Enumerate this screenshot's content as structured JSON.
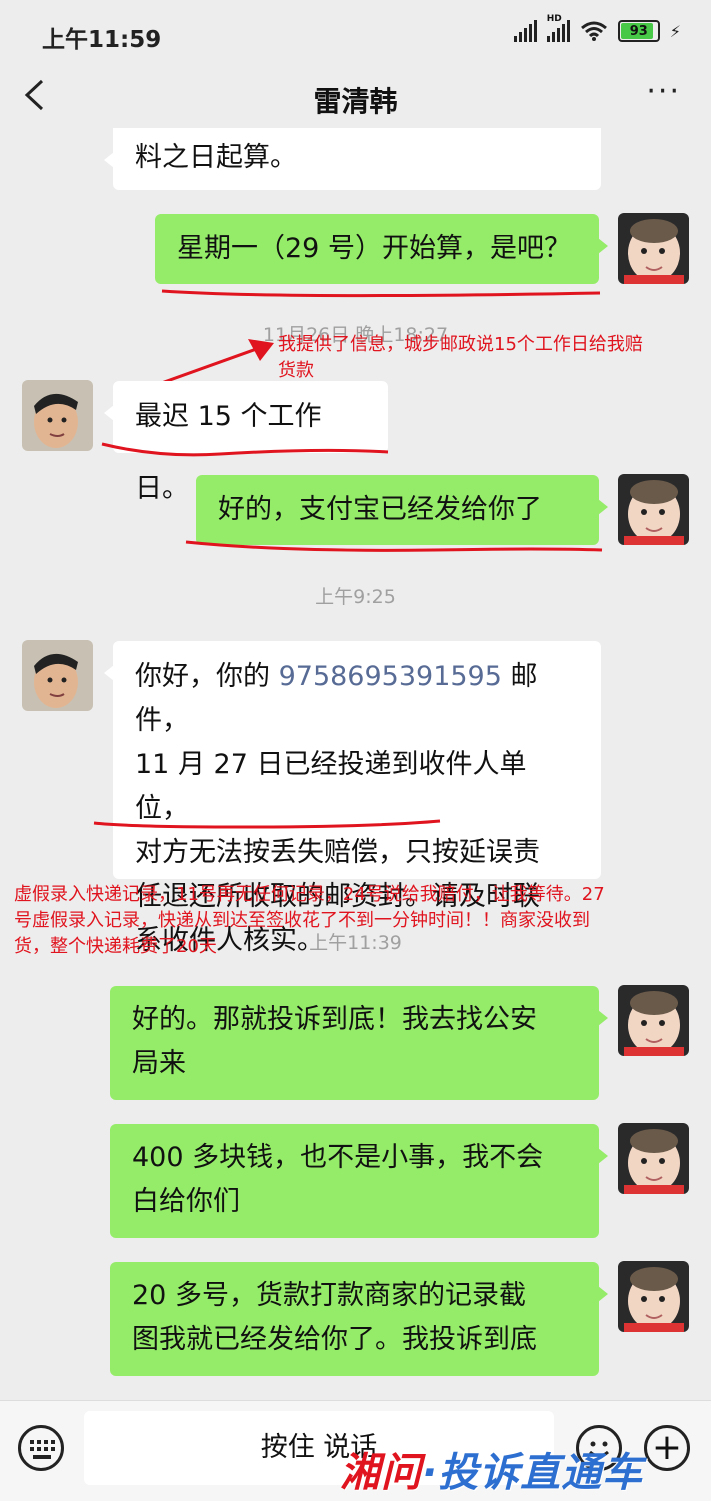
{
  "status_bar": {
    "time": "上午11:59",
    "battery": "93",
    "hd": "HD"
  },
  "header": {
    "title": "雷清韩"
  },
  "messages": [
    {
      "side": "left",
      "text": "料之日起算。"
    },
    {
      "side": "right",
      "text": "星期一（29 号）开始算，是吧？"
    },
    {
      "side": "left",
      "text": "最迟 15 个工作日。"
    },
    {
      "side": "right",
      "text": "好的，支付宝已经发给你了"
    },
    {
      "side": "left",
      "lines": [
        "你好，你的 ",
        "9758695391595",
        " 邮件，",
        "11 月 27 日已经投递到收件人单位，",
        "对方无法按丢失赔偿，只按延误责",
        "任退还所收取的邮资封。请及时联",
        "系收件人核实。"
      ]
    },
    {
      "side": "right",
      "lines": [
        "好的。那就投诉到底！我去找公安",
        "局来"
      ]
    },
    {
      "side": "right",
      "lines": [
        "400 多块钱，也不是小事，我不会",
        "白给你们"
      ]
    },
    {
      "side": "right",
      "lines": [
        "20 多号，货款打款商家的记录截",
        "图我就已经发给你了。我投诉到底"
      ]
    }
  ],
  "timestamps": [
    "11月26日 晚上18:27",
    "上午9:25",
    "上午11:39"
  ],
  "annotations": [
    {
      "lines": [
        "我提供了信息，城步邮政说15个工作日给我赔",
        "货款"
      ]
    },
    {
      "lines": [
        "虚假录入快递记录，11号再无任何记录，24号说给我赔付，让我等待。27",
        "号虚假录入记录，快递从到达至签收花了不到一分钟时间！！商家没收到",
        "货，整个快递耗费了20天"
      ]
    }
  ],
  "input": {
    "hold_to_talk": "按住 说话"
  },
  "watermark": {
    "part1": "湘问",
    "part2": "·投诉直通车"
  },
  "colors": {
    "green_bubble": "#95ec69",
    "annotation_red": "#e0141e",
    "number_link": "#576b95",
    "background": "#ededed"
  },
  "icons": {
    "back": "chevron-left-icon",
    "more": "more-dots-icon",
    "keyboard": "keyboard-icon",
    "emoji": "emoji-icon",
    "plus": "plus-icon"
  }
}
